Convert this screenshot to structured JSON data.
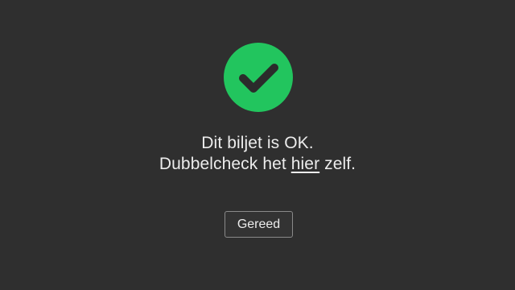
{
  "status": {
    "icon": "check-circle-icon",
    "color": "#22c55e"
  },
  "message": {
    "line1": "Dit biljet is OK.",
    "line2_prefix": "Dubbelcheck het ",
    "line2_link": "hier",
    "line2_suffix": " zelf."
  },
  "actions": {
    "done_label": "Gereed"
  }
}
